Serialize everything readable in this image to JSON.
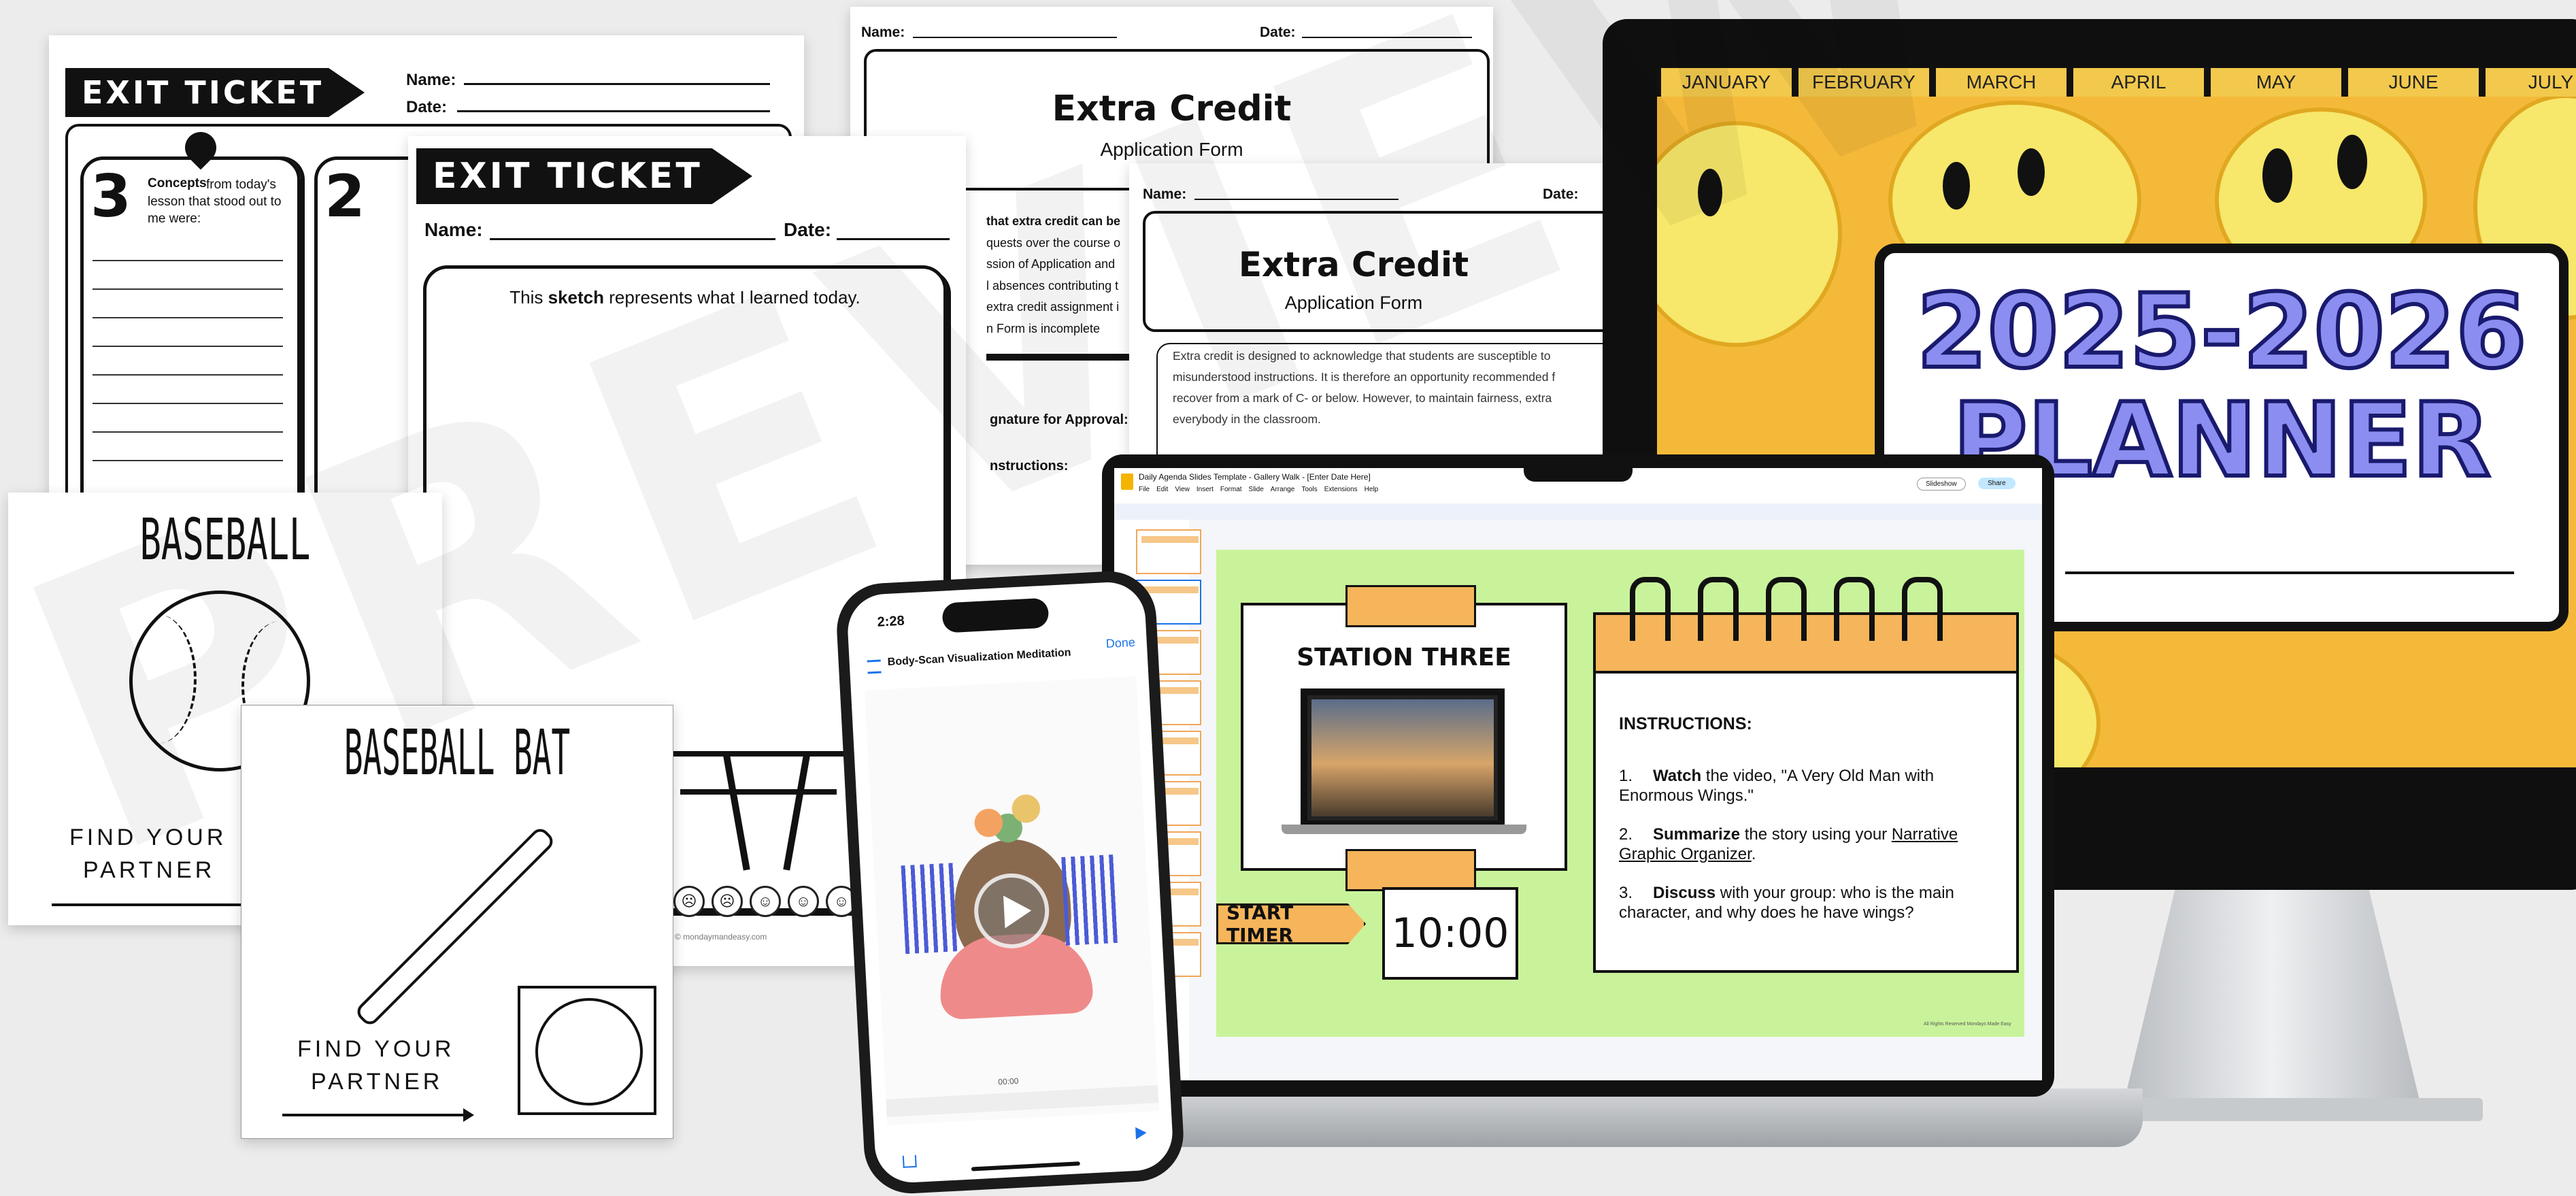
{
  "exit_ticket_back": {
    "title": "EXIT TICKET",
    "name_label": "Name:",
    "date_label": "Date:",
    "col1_number": "3",
    "col1_bold": "Concepts",
    "col1_text": "from today's lesson that stood out to me were:",
    "col2_number": "2"
  },
  "exit_ticket_front": {
    "title": "EXIT TICKET",
    "name_label": "Name:",
    "date_label": "Date:",
    "prompt_pre": "This",
    "prompt_bold": "sketch",
    "prompt_post": "represents what I learned today.",
    "footer_url": "© mondaymandeasy.com"
  },
  "extra_credit_back": {
    "name_label": "Name:",
    "date_label": "Date:",
    "title": "Extra Credit",
    "subtitle": "Application Form",
    "lines": [
      "that extra credit can be",
      "quests over the course o",
      "ssion of Application and",
      "l absences contributing t",
      "extra credit assignment i",
      "n Form is incomplete"
    ],
    "signature_label": "gnature for Approval:",
    "instructions_label": "nstructions:"
  },
  "extra_credit_front": {
    "name_label": "Name:",
    "date_label": "Date:",
    "title": "Extra Credit",
    "subtitle": "Application Form",
    "paragraph": "Extra credit is designed to acknowledge that students are susceptible to misunderstood instructions. It is therefore an opportunity recommended f recover from a mark of C- or below. However, to maintain fairness, extra everybody in the classroom."
  },
  "baseball_card": {
    "title": "BASEBALL",
    "footer_line1": "FIND YOUR",
    "footer_line2": "PARTNER"
  },
  "baseball_bat_card": {
    "title": "BASEBALL BAT",
    "footer_line1": "FIND YOUR",
    "footer_line2": "PARTNER"
  },
  "monitor": {
    "months": [
      "JANUARY",
      "FEBRUARY",
      "MARCH",
      "APRIL",
      "MAY",
      "JUNE",
      "JULY"
    ],
    "planner_line1": "2025-2026",
    "planner_line2": "PLANNER",
    "colon": ":"
  },
  "laptop": {
    "doc_title": "Daily Agenda Slides Template - Gallery Walk - [Enter Date Here]",
    "menu": [
      "File",
      "Edit",
      "View",
      "Insert",
      "Format",
      "Slide",
      "Arrange",
      "Tools",
      "Extensions",
      "Help"
    ],
    "slideshow_label": "Slideshow",
    "share_label": "Share",
    "station_title": "STATION THREE",
    "start_timer_label": "START TIMER",
    "timer_value": "10:00",
    "instructions_heading": "INSTRUCTIONS:",
    "steps": [
      {
        "num": "1.",
        "bold": "Watch",
        "text": "the video, \"A Very Old Man with Enormous Wings.\""
      },
      {
        "num": "2.",
        "bold": "Summarize",
        "text": "the story using your",
        "link": "Narrative Graphic Organizer",
        "after": "."
      },
      {
        "num": "3.",
        "bold": "Discuss",
        "text": "with your group: who is the main character, and why does he have wings?"
      }
    ],
    "copyright": "All Rights Reserved Mondays Made Easy"
  },
  "phone": {
    "time": "2:28",
    "title": "Body-Scan Visualization Meditation",
    "done_label": "Done",
    "progress_time": "00:00"
  },
  "watermark": "PREVIEW",
  "colors": {
    "slide_bg": "#c9f39b",
    "accent_orange": "#f6b55a",
    "monitor_yellow": "#f7c44a",
    "planner_purple": "#8b8ef0"
  }
}
